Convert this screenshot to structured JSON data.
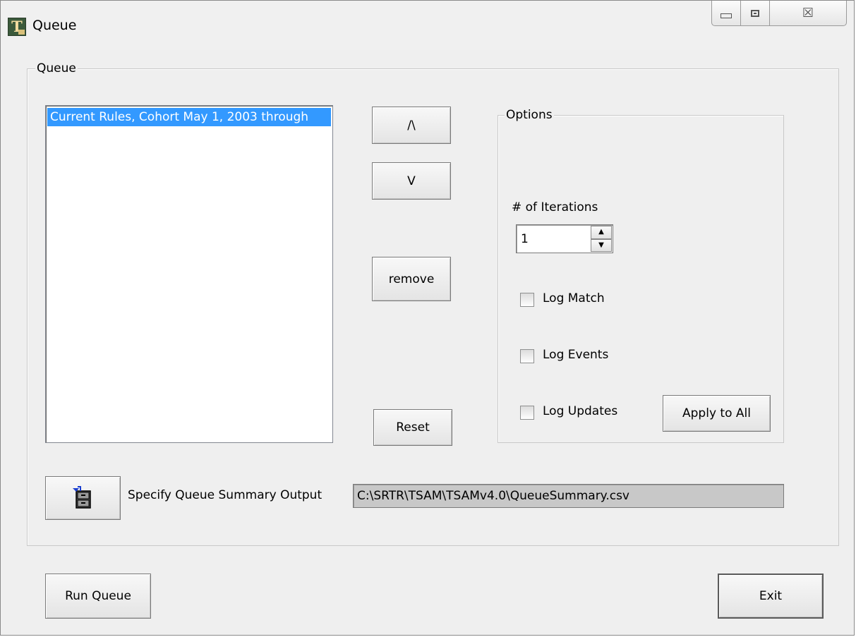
{
  "window": {
    "title": "Queue",
    "app_icon_letter": "T",
    "controls": {
      "minimize_icon": "minimize-icon",
      "maximize_icon": "maximize-icon",
      "close_glyph": "☒"
    }
  },
  "queue_group": {
    "label": "Queue",
    "list_items": [
      "Current Rules, Cohort May 1, 2003 through"
    ],
    "selected_index": 0
  },
  "buttons": {
    "move_up": "/\\",
    "move_down": "V",
    "remove": "remove",
    "reset": "Reset",
    "apply_to_all": "Apply to All",
    "run_queue": "Run Queue",
    "exit": "Exit"
  },
  "options_group": {
    "label": "Options",
    "iterations_label": "# of Iterations",
    "iterations_value": "1",
    "checkboxes": [
      {
        "label": "Log Match",
        "checked": false
      },
      {
        "label": "Log Events",
        "checked": false
      },
      {
        "label": "Log Updates",
        "checked": false
      }
    ]
  },
  "output": {
    "label": "Specify Queue Summary Output",
    "path": "C:\\SRTR\\TSAM\\TSAMv4.0\\QueueSummary.csv",
    "file_button_icon": "file-cabinet-icon"
  }
}
